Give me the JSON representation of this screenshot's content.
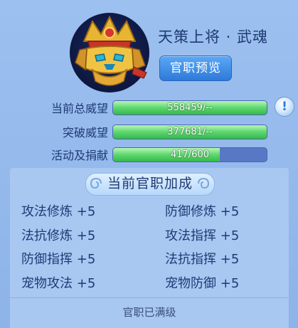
{
  "title": "天策上将 · 武魂",
  "preview_button": "官职预览",
  "stats": [
    {
      "label": "当前总威望",
      "text": "558459/--",
      "fill": 1.0
    },
    {
      "label": "突破威望",
      "text": "377681/--",
      "fill": 1.0
    },
    {
      "label": "活动及捐献",
      "text": "417/600",
      "fill": 0.695
    }
  ],
  "section_title": "当前官职加成",
  "bonuses": [
    {
      "name": "攻法修炼",
      "value": "+5"
    },
    {
      "name": "防御修炼",
      "value": "+5"
    },
    {
      "name": "法抗修炼",
      "value": "+5"
    },
    {
      "name": "攻法指挥",
      "value": "+5"
    },
    {
      "name": "防御指挥",
      "value": "+5"
    },
    {
      "name": "法抗指挥",
      "value": "+5"
    },
    {
      "name": "宠物攻法",
      "value": "+5"
    },
    {
      "name": "宠物防御",
      "value": "+5"
    }
  ],
  "footer": "官职已满级",
  "icons": {
    "emblem": "golden-helmet-icon",
    "info": "info-icon"
  },
  "colors": {
    "bar_fill": "#5ed66e",
    "bar_track": "#5878c6",
    "button": "#2e7ad8"
  }
}
